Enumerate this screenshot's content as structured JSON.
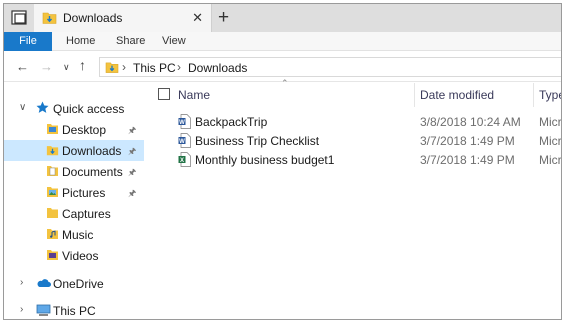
{
  "window": {
    "tab_title": "Downloads",
    "tab_close": "✕",
    "new_tab": "+"
  },
  "ribbon": {
    "file": "File",
    "tabs": [
      "Home",
      "Share",
      "View"
    ]
  },
  "address": {
    "crumbs": [
      "This PC",
      "Downloads"
    ],
    "separator": "›"
  },
  "sidebar": {
    "items": [
      {
        "label": "Quick access",
        "icon": "star-icon"
      },
      {
        "label": "Desktop",
        "icon": "folder-icon",
        "pinned": true
      },
      {
        "label": "Downloads",
        "icon": "downloads-folder-icon",
        "pinned": true,
        "selected": true
      },
      {
        "label": "Documents",
        "icon": "documents-folder-icon",
        "pinned": true
      },
      {
        "label": "Pictures",
        "icon": "pictures-folder-icon",
        "pinned": true
      },
      {
        "label": "Captures",
        "icon": "folder-icon"
      },
      {
        "label": "Music",
        "icon": "music-folder-icon"
      },
      {
        "label": "Videos",
        "icon": "videos-folder-icon"
      },
      {
        "label": "OneDrive",
        "icon": "cloud-icon"
      },
      {
        "label": "This PC",
        "icon": "computer-icon"
      }
    ]
  },
  "list": {
    "columns": [
      "Name",
      "Date modified",
      "Type"
    ],
    "rows": [
      {
        "name": "BackpackTrip",
        "date": "3/8/2018 10:24 AM",
        "type": "Micro",
        "icon": "word-doc-icon"
      },
      {
        "name": "Business Trip Checklist",
        "date": "3/7/2018 1:49 PM",
        "type": "Micro",
        "icon": "word-doc-icon"
      },
      {
        "name": "Monthly business budget1",
        "date": "3/7/2018 1:49 PM",
        "type": "Micro",
        "icon": "excel-sheet-icon"
      }
    ]
  },
  "colors": {
    "accent": "#1979ca",
    "selected": "#cce8ff",
    "folder": "#f3c33f"
  }
}
